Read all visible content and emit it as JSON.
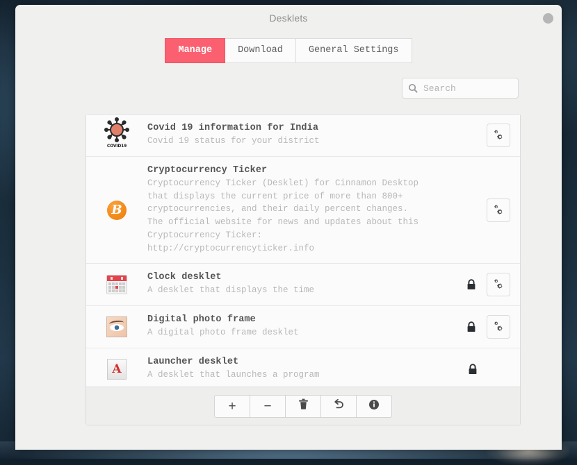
{
  "window": {
    "title": "Desklets",
    "close_icon": "close-circle-icon"
  },
  "tabs": [
    {
      "label": "Manage",
      "active": true
    },
    {
      "label": "Download",
      "active": false
    },
    {
      "label": "General Settings",
      "active": false
    }
  ],
  "search": {
    "placeholder": "Search",
    "value": "",
    "icon": "search-icon"
  },
  "list": [
    {
      "icon": "covid19-icon",
      "title": "Covid 19 information for India",
      "description": "Covid 19 status for your district",
      "locked": false,
      "has_config": true
    },
    {
      "icon": "bitcoin-icon",
      "title": "Cryptocurrency Ticker",
      "description": "Cryptocurrency Ticker (Desklet) for Cinnamon Desktop that displays the current price of more than 800+ cryptocurrencies, and their daily percent changes. The official website for news and updates about this Cryptocurrency Ticker: http://cryptocurrencyticker.info",
      "locked": false,
      "has_config": true
    },
    {
      "icon": "calendar-clock-icon",
      "title": "Clock desklet",
      "description": "A desklet that displays the time",
      "locked": true,
      "has_config": true
    },
    {
      "icon": "photo-eye-icon",
      "title": "Digital photo frame",
      "description": "A digital photo frame desklet",
      "locked": true,
      "has_config": true
    },
    {
      "icon": "launcher-icon",
      "title": "Launcher desklet",
      "description": "A desklet that launches a program",
      "locked": true,
      "has_config": false
    }
  ],
  "toolbar": [
    {
      "name": "add",
      "glyph": "+"
    },
    {
      "name": "remove",
      "glyph": "−"
    },
    {
      "name": "trash",
      "glyph": "🗑"
    },
    {
      "name": "restore",
      "glyph": "↶"
    },
    {
      "name": "info",
      "glyph": "ⓘ"
    }
  ],
  "colors": {
    "accent": "#fb6070",
    "window_bg": "#f0f0ef",
    "list_bg": "#fbfbfb",
    "title_text": "#8e8e8e",
    "row_title": "#555555",
    "row_desc": "#b8b8b8"
  }
}
